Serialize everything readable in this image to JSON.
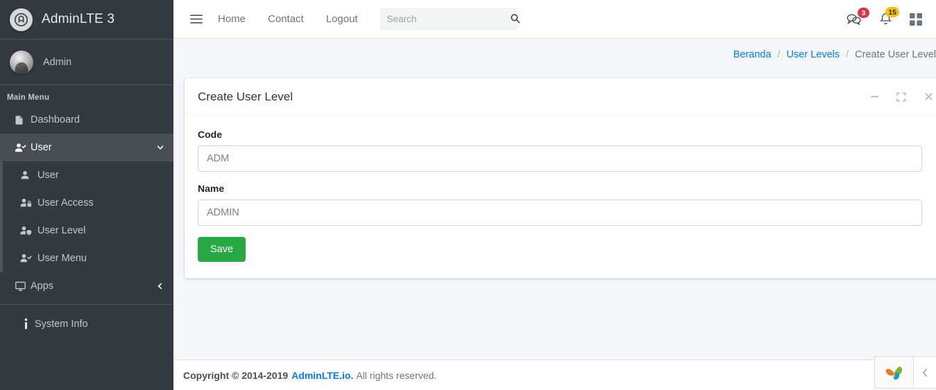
{
  "brand": {
    "name": "AdminLTE 3",
    "logo_icon": "circle-a-logo-icon"
  },
  "user_panel": {
    "name": "Admin",
    "avatar_icon": "user-avatar"
  },
  "sidebar": {
    "header": "Main Menu",
    "items": [
      {
        "label": "Dashboard",
        "icon": "file-icon",
        "active": false
      },
      {
        "label": "User",
        "icon": "user-check-icon",
        "active": true,
        "chevron": "chevron-down-icon"
      },
      {
        "label": "Apps",
        "icon": "desktop-icon",
        "active": false,
        "chevron": "chevron-left-icon"
      },
      {
        "label": "System Info",
        "icon": "info-icon",
        "active": false
      }
    ],
    "submenu": [
      {
        "label": "User",
        "icon": "user-icon"
      },
      {
        "label": "User Access",
        "icon": "user-lock-icon"
      },
      {
        "label": "User Level",
        "icon": "user-shield-icon"
      },
      {
        "label": "User Menu",
        "icon": "user-check-icon"
      }
    ]
  },
  "navbar": {
    "toggle_icon": "hamburger-icon",
    "links": [
      "Home",
      "Contact",
      "Logout"
    ],
    "search": {
      "value": "",
      "placeholder": "Search",
      "icon": "search-icon"
    },
    "right_icons": [
      {
        "icon": "comments-icon",
        "badge": "3",
        "badge_color": "#dc3545"
      },
      {
        "icon": "bell-icon",
        "badge": "15",
        "badge_color": "#ffc107"
      },
      {
        "icon": "grid-icon",
        "badge": ""
      }
    ]
  },
  "breadcrumb": {
    "items": [
      {
        "label": "Beranda",
        "link": true
      },
      {
        "label": "User Levels",
        "link": true
      },
      {
        "label": "Create User Level",
        "link": false
      }
    ],
    "separator": "/"
  },
  "card": {
    "title": "Create User Level",
    "tools": [
      {
        "icon": "minus-icon",
        "name": "collapse"
      },
      {
        "icon": "expand-icon",
        "name": "maximize"
      },
      {
        "icon": "close-icon",
        "name": "close"
      }
    ],
    "form": {
      "fields": [
        {
          "label": "Code",
          "value": "",
          "placeholder": "ADM",
          "name": "code"
        },
        {
          "label": "Name",
          "value": "",
          "placeholder": "ADMIN",
          "name": "name"
        }
      ],
      "submit_label": "Save",
      "submit_color": "#28a745"
    }
  },
  "footer": {
    "copyright": "Copyright © 2014-2019",
    "link": "AdminLTE.io.",
    "rest": "All rights reserved."
  },
  "float_widget": {
    "logo_icon": "yandex-petal-logo-icon",
    "toggle_icon": "chevron-left-icon"
  },
  "colors": {
    "sidebar_bg": "#343a40",
    "sidebar_active": "#494e53",
    "content_bg": "#f4f6f9",
    "link_blue": "#007bff",
    "success_green": "#28a745",
    "danger_red": "#dc3545",
    "warning_yellow": "#ffc107"
  }
}
